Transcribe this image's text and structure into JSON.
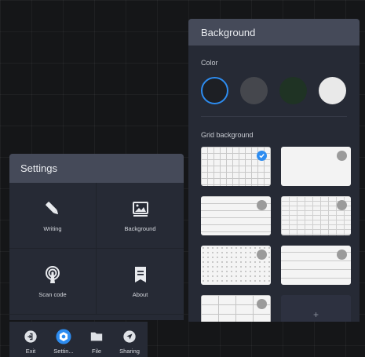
{
  "settings": {
    "title": "Settings",
    "items": [
      {
        "label": "Writing",
        "icon": "pen-icon"
      },
      {
        "label": "Background",
        "icon": "image-icon"
      },
      {
        "label": "Scan code",
        "icon": "broadcast-icon"
      },
      {
        "label": "About",
        "icon": "bookmark-icon"
      }
    ]
  },
  "background": {
    "title": "Background",
    "color_label": "Color",
    "colors": [
      {
        "name": "black",
        "hex": "#1d1f24",
        "selected": true,
        "ring": "#2d8cf0"
      },
      {
        "name": "dark-gray",
        "hex": "#45474d",
        "selected": false
      },
      {
        "name": "dark-green",
        "hex": "#1f3324",
        "selected": false
      },
      {
        "name": "white",
        "hex": "#e9e9e9",
        "selected": false
      }
    ],
    "grid_label": "Grid background",
    "grid_tiles": [
      {
        "style": "grid",
        "selected": true
      },
      {
        "style": "plain",
        "selected": false
      },
      {
        "style": "lines",
        "selected": false
      },
      {
        "style": "tall-grid",
        "selected": false
      },
      {
        "style": "dots",
        "selected": false
      },
      {
        "style": "wide-lines",
        "selected": false
      },
      {
        "style": "boxes",
        "selected": false
      },
      {
        "style": "add",
        "selected": false,
        "label": "+"
      }
    ]
  },
  "toolbar": {
    "items": [
      {
        "label": "Exit",
        "icon": "exit-icon",
        "active": false
      },
      {
        "label": "Settin...",
        "icon": "settings-icon",
        "active": true
      },
      {
        "label": "File",
        "icon": "folder-icon",
        "active": false
      },
      {
        "label": "Sharing",
        "icon": "share-icon",
        "active": false
      }
    ]
  },
  "colors": {
    "accent": "#2d8cf0",
    "panel": "#262a35",
    "panel_header": "#454a59"
  }
}
